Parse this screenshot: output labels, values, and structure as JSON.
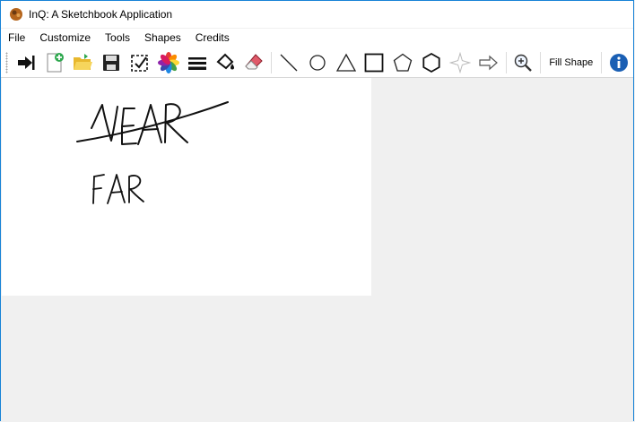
{
  "window": {
    "title": "InQ: A Sketchbook Application"
  },
  "menu": {
    "items": [
      "File",
      "Customize",
      "Tools",
      "Shapes",
      "Credits"
    ]
  },
  "toolbar": {
    "fill_shape_label": "Fill Shape",
    "buttons": [
      "exit-icon",
      "new-file-icon",
      "open-folder-icon",
      "save-icon",
      "select-icon",
      "color-picker-icon",
      "line-width-icon",
      "paint-bucket-icon",
      "eraser-icon",
      "line-tool-icon",
      "circle-tool-icon",
      "triangle-tool-icon",
      "rectangle-tool-icon",
      "pentagon-tool-icon",
      "hexagon-tool-icon",
      "star-tool-icon",
      "arrow-tool-icon",
      "zoom-icon",
      "info-icon"
    ]
  },
  "colors": {
    "accent": "#1883d7",
    "info_blue": "#1a5fb4",
    "canvas_bg": "#ffffff",
    "workspace_bg": "#f0f0f0"
  },
  "canvas": {
    "sketch_words": [
      "NEAR",
      "FAR"
    ]
  }
}
